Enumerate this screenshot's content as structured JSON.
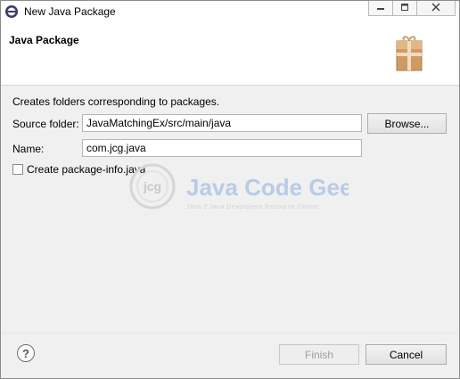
{
  "window": {
    "title": "New Java Package",
    "accent": "#0078d7"
  },
  "banner": {
    "title": "Java Package",
    "graphic": "package-icon"
  },
  "form": {
    "description": "Creates folders corresponding to packages.",
    "source_folder_label": "Source folder:",
    "source_folder_value": "JavaMatchingEx/src/main/java",
    "browse_label": "Browse...",
    "name_label": "Name:",
    "name_value": "com.jcg.java",
    "package_info_label": "Create package-info.java",
    "package_info_checked": false
  },
  "watermark": {
    "logo_letters": "jcg",
    "brand": "Java Code Geeks",
    "tagline": "Java 2 Java Developers Resource Center"
  },
  "footer": {
    "help_icon": "question-icon",
    "help_glyph": "?",
    "finish_label": "Finish",
    "finish_enabled": false,
    "cancel_label": "Cancel"
  }
}
